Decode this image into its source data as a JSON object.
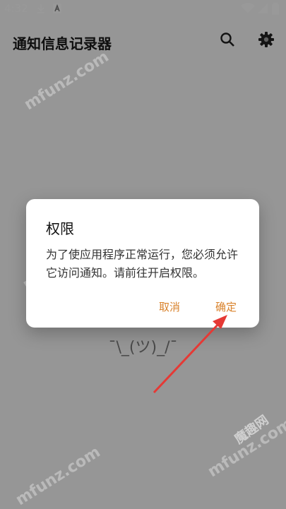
{
  "status_bar": {
    "time": "4:32",
    "icons": [
      "download-icon",
      "a-badge-icon",
      "wifi-icon",
      "signal-icon",
      "battery-icon"
    ]
  },
  "app_bar": {
    "title": "通知信息记录器",
    "actions": [
      "search-icon",
      "gear-icon"
    ]
  },
  "empty_state": {
    "shrug": "¯\\_(ツ)_/¯"
  },
  "dialog": {
    "title": "权限",
    "message": "为了使应用程序正常运行，您必须允许它访问通知。请前往开启权限。",
    "cancel_label": "取消",
    "ok_label": "确定"
  },
  "watermark": {
    "text": "mfunz.com",
    "badge": "魔趣网"
  },
  "colors": {
    "accent": "#d9822b",
    "annotation_arrow": "#e53935"
  }
}
